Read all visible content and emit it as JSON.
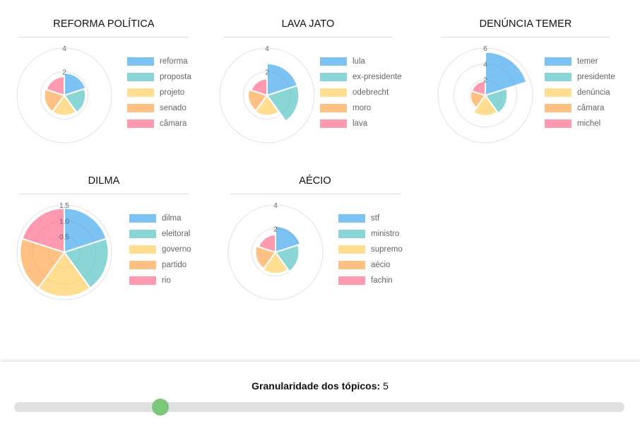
{
  "colors": {
    "palette": [
      "#36a2eb",
      "#4bc0c0",
      "#ffcd56",
      "#ff9f40",
      "#ff6384"
    ],
    "slider_thumb": "#7dc67c",
    "slider_track": "#e0e0e0"
  },
  "chart_data": [
    {
      "type": "polarArea",
      "title": "REFORMA POLÍTICA",
      "categories": [
        "reforma",
        "proposta",
        "projeto",
        "senado",
        "câmara"
      ],
      "values": [
        1.9,
        1.8,
        1.7,
        1.7,
        1.6
      ],
      "rmax": 4,
      "tick_labels": [
        "2",
        "4"
      ],
      "legend_position": "right"
    },
    {
      "type": "polarArea",
      "title": "LAVA JATO",
      "categories": [
        "lula",
        "ex-presidente",
        "odebrecht",
        "moro",
        "lava"
      ],
      "values": [
        2.7,
        2.7,
        1.7,
        1.6,
        1.4
      ],
      "rmax": 4,
      "tick_labels": [
        "2",
        "4"
      ],
      "legend_position": "right"
    },
    {
      "type": "polarArea",
      "title": "DENÚNCIA TEMER",
      "categories": [
        "temer",
        "presidente",
        "denúncia",
        "câmara",
        "michel"
      ],
      "values": [
        5.5,
        2.8,
        2.6,
        1.9,
        1.8
      ],
      "rmax": 6,
      "tick_labels": [
        "2",
        "4",
        "6"
      ],
      "legend_position": "right"
    },
    {
      "type": "polarArea",
      "title": "DILMA",
      "categories": [
        "dilma",
        "eleitoral",
        "governo",
        "partido",
        "rio"
      ],
      "values": [
        1.4,
        1.4,
        1.4,
        1.4,
        1.4
      ],
      "rmax": 1.5,
      "tick_labels": [
        "0.5",
        "1.0",
        "1.5"
      ],
      "legend_position": "right"
    },
    {
      "type": "polarArea",
      "title": "AÉCIO",
      "categories": [
        "stf",
        "ministro",
        "supremo",
        "aécio",
        "fachin"
      ],
      "values": [
        2.2,
        2.0,
        1.8,
        1.7,
        1.5
      ],
      "rmax": 4,
      "tick_labels": [
        "2",
        "4"
      ],
      "legend_position": "right"
    }
  ],
  "granularity": {
    "label": "Granularidade dos tópicos:",
    "value": "5",
    "slider_fraction": 0.24
  }
}
